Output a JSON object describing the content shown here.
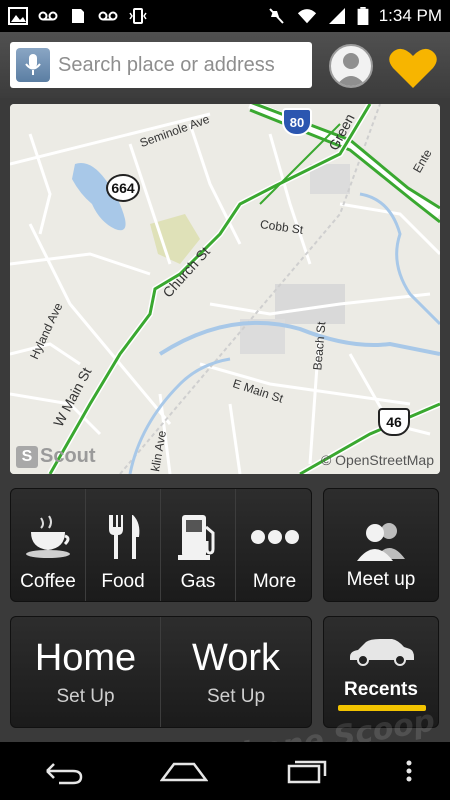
{
  "status_bar": {
    "time": "1:34 PM"
  },
  "search": {
    "placeholder": "Search place or address"
  },
  "map": {
    "street_labels": [
      "Seminole Ave",
      "Church St",
      "Cobb St",
      "Hyland Ave",
      "W Main St",
      "E Main St",
      "Beach St",
      "klin Ave",
      "Green",
      "Ente"
    ],
    "route_shields": [
      "80",
      "664",
      "46"
    ],
    "brand": "Scout",
    "attribution": "© OpenStreetMap"
  },
  "categories": [
    {
      "label": "Coffee",
      "icon": "coffee-cup-icon"
    },
    {
      "label": "Food",
      "icon": "fork-knife-icon"
    },
    {
      "label": "Gas",
      "icon": "gas-pump-icon"
    },
    {
      "label": "More",
      "icon": "more-dots-icon"
    }
  ],
  "meetup": {
    "label": "Meet up",
    "icon": "people-icon"
  },
  "places": [
    {
      "title": "Home",
      "sub": "Set Up"
    },
    {
      "title": "Work",
      "sub": "Set Up"
    }
  ],
  "recents": {
    "label": "Recents",
    "icon": "car-icon"
  },
  "colors": {
    "accent": "#f2c300",
    "route_green": "#3aa830",
    "heart": "#f7b500"
  },
  "watermark": "Phone Scoop"
}
